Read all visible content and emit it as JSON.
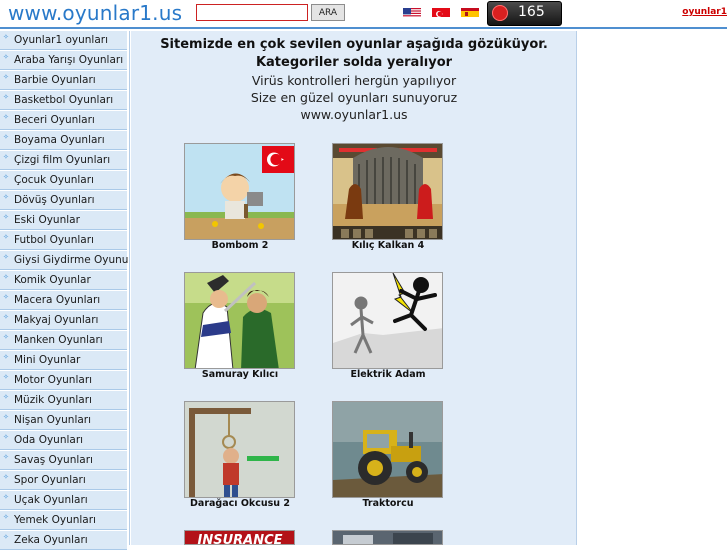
{
  "header": {
    "site_title": "www.oyunlar1.us",
    "search": {
      "value": "",
      "placeholder": ""
    },
    "search_button_label": "ARA",
    "flags": [
      "us-flag",
      "tr-flag",
      "es-flag"
    ],
    "counter": "165",
    "top_link": "oyunlar1"
  },
  "sidebar": {
    "items": [
      {
        "label": "Oyunlar1 oyunları"
      },
      {
        "label": "Araba Yarışı Oyunları"
      },
      {
        "label": "Barbie Oyunları"
      },
      {
        "label": "Basketbol Oyunları"
      },
      {
        "label": "Beceri Oyunları"
      },
      {
        "label": "Boyama Oyunları"
      },
      {
        "label": "Çizgi film Oyunları"
      },
      {
        "label": "Çocuk Oyunları"
      },
      {
        "label": "Dövüş Oyunları"
      },
      {
        "label": "Eski Oyunlar"
      },
      {
        "label": "Futbol Oyunları"
      },
      {
        "label": "Giysi Giydirme Oyunu"
      },
      {
        "label": "Komik Oyunlar"
      },
      {
        "label": "Macera Oyunları"
      },
      {
        "label": "Makyaj Oyunları"
      },
      {
        "label": "Manken Oyunları"
      },
      {
        "label": "Mini Oyunlar"
      },
      {
        "label": "Motor Oyunları"
      },
      {
        "label": "Müzik Oyunları"
      },
      {
        "label": "Nişan Oyunları"
      },
      {
        "label": "Oda Oyunları"
      },
      {
        "label": "Savaş Oyunları"
      },
      {
        "label": "Spor Oyunları"
      },
      {
        "label": "Uçak Oyunları"
      },
      {
        "label": "Yemek Oyunları"
      },
      {
        "label": "Zeka Oyunları"
      }
    ]
  },
  "main": {
    "heading": "Sitemizde en çok sevilen oyunlar aşağıda gözüküyor. Kategoriler solda yeralıyor",
    "lines": [
      "Virüs kontrolleri hergün yapılıyor",
      "Size en güzel oyunları sunuyoruz",
      "www.oyunlar1.us"
    ],
    "games": [
      {
        "title": "Bombom 2"
      },
      {
        "title": "Kılıç Kalkan 4"
      },
      {
        "title": "Samuray Kılıcı"
      },
      {
        "title": "Elektrik Adam"
      },
      {
        "title": "Darağacı Okcusu 2"
      },
      {
        "title": "Traktorcu"
      }
    ],
    "partial_banner_text": "INSURANCE"
  },
  "colors": {
    "title_blue": "#2979c9",
    "sidebar_bg": "#dbe9f6",
    "main_bg": "#e1ecf8",
    "link_red": "#cc0000"
  }
}
